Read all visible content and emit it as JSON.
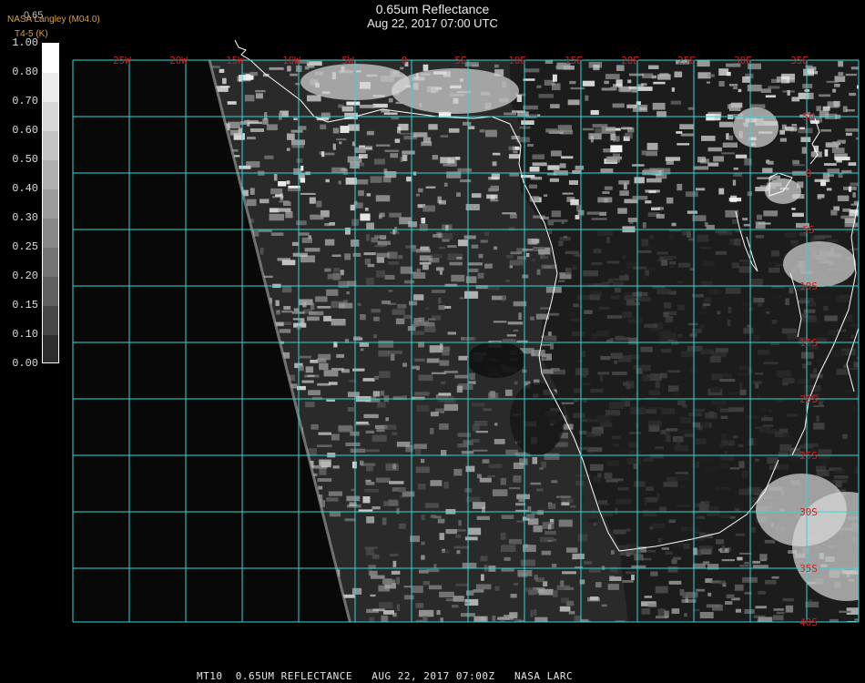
{
  "header": {
    "title": "0.65um Reflectance",
    "datetime": "Aug 22, 2017 07:00 UTC",
    "agency": "NASA Langley (M04.0)",
    "product_code": "T4-5 (K)",
    "ghost_value": "0.65"
  },
  "colorbar": {
    "labels": [
      "1.00",
      "0.80",
      "0.70",
      "0.60",
      "0.50",
      "0.40",
      "0.30",
      "0.25",
      "0.20",
      "0.15",
      "0.10",
      "0.00"
    ]
  },
  "map": {
    "lon_labels": [
      "25W",
      "20W",
      "15W",
      "10W",
      "5W",
      "0",
      "5E",
      "10E",
      "15E",
      "20E",
      "25E",
      "30E",
      "35E"
    ],
    "lat_labels": [
      "5N",
      "0",
      "5S",
      "10S",
      "15S",
      "20S",
      "25S",
      "30S",
      "35S",
      "40S"
    ],
    "grid_color": "#33d6d6",
    "label_color": "#cc2020",
    "coast_color": "#ffffff"
  },
  "footer": {
    "caption": "MT10  0.65UM REFLECTANCE   AUG 22, 2017 07:00Z   NASA LARC"
  }
}
